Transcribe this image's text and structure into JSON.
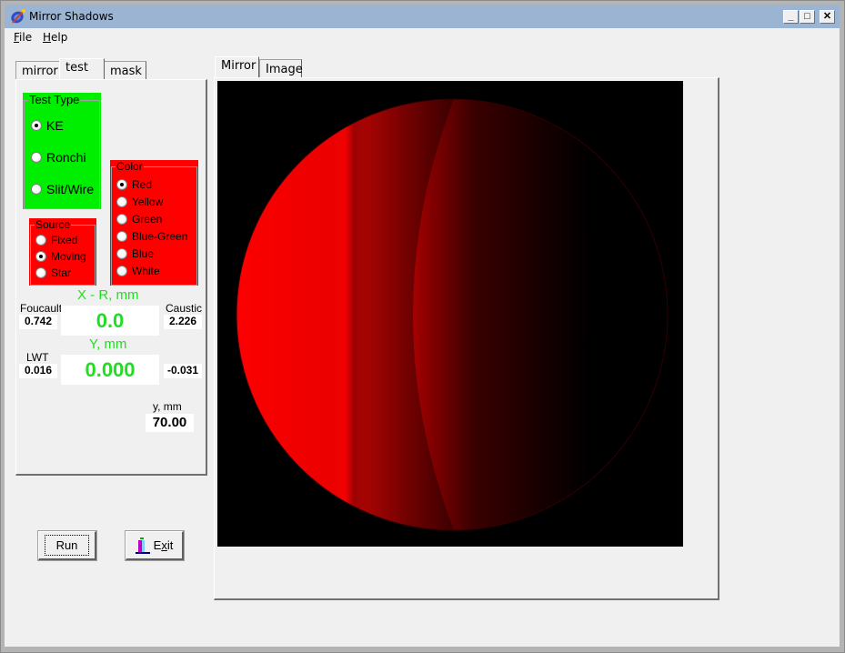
{
  "window": {
    "title": "Mirror Shadows",
    "controls": {
      "minimize": "_",
      "maximize": "□",
      "close": "✕"
    }
  },
  "menu": {
    "file": {
      "accel": "F",
      "rest": "ile"
    },
    "help": {
      "accel": "H",
      "rest": "elp"
    }
  },
  "left_tabs": [
    {
      "label": "mirror",
      "active": false
    },
    {
      "label": "test",
      "active": true
    },
    {
      "label": "mask",
      "active": false
    }
  ],
  "test_type": {
    "title": "Test Type",
    "color": "#00ee00",
    "options": [
      "KE",
      "Ronchi",
      "Slit/Wire"
    ],
    "selected": "KE"
  },
  "color_group": {
    "title": "Color",
    "color": "#ff0000",
    "options": [
      "Red",
      "Yellow",
      "Green",
      "Blue-Green",
      "Blue",
      "White"
    ],
    "selected": "Red"
  },
  "source_group": {
    "title": "Source",
    "color": "#ff0000",
    "options": [
      "Fixed",
      "Moving",
      "Star"
    ],
    "selected": "Moving"
  },
  "readouts": {
    "x_label": "X - R, mm",
    "x_value": "0.0",
    "y_label": "Y, mm",
    "y_value": "0.000",
    "foucault_label": "Foucault",
    "foucault_value": "0.742",
    "caustic_label": "Caustic",
    "caustic_value": "2.226",
    "lwt_label": "LWT",
    "lwt_value": "0.016",
    "caustic_y_value": "-0.031",
    "small_y_label": "y, mm",
    "small_y_value": "70.00"
  },
  "buttons": {
    "run": "Run",
    "exit_accel_prefix": "E",
    "exit_accel": "x",
    "exit_rest": "it"
  },
  "right_tabs": [
    {
      "label": "Mirror",
      "active": true
    },
    {
      "label": "Image",
      "active": false
    }
  ],
  "mirror_view": {
    "description": "Knife-edge shadow pattern on mirror",
    "shadow_color": "#ff0000"
  }
}
